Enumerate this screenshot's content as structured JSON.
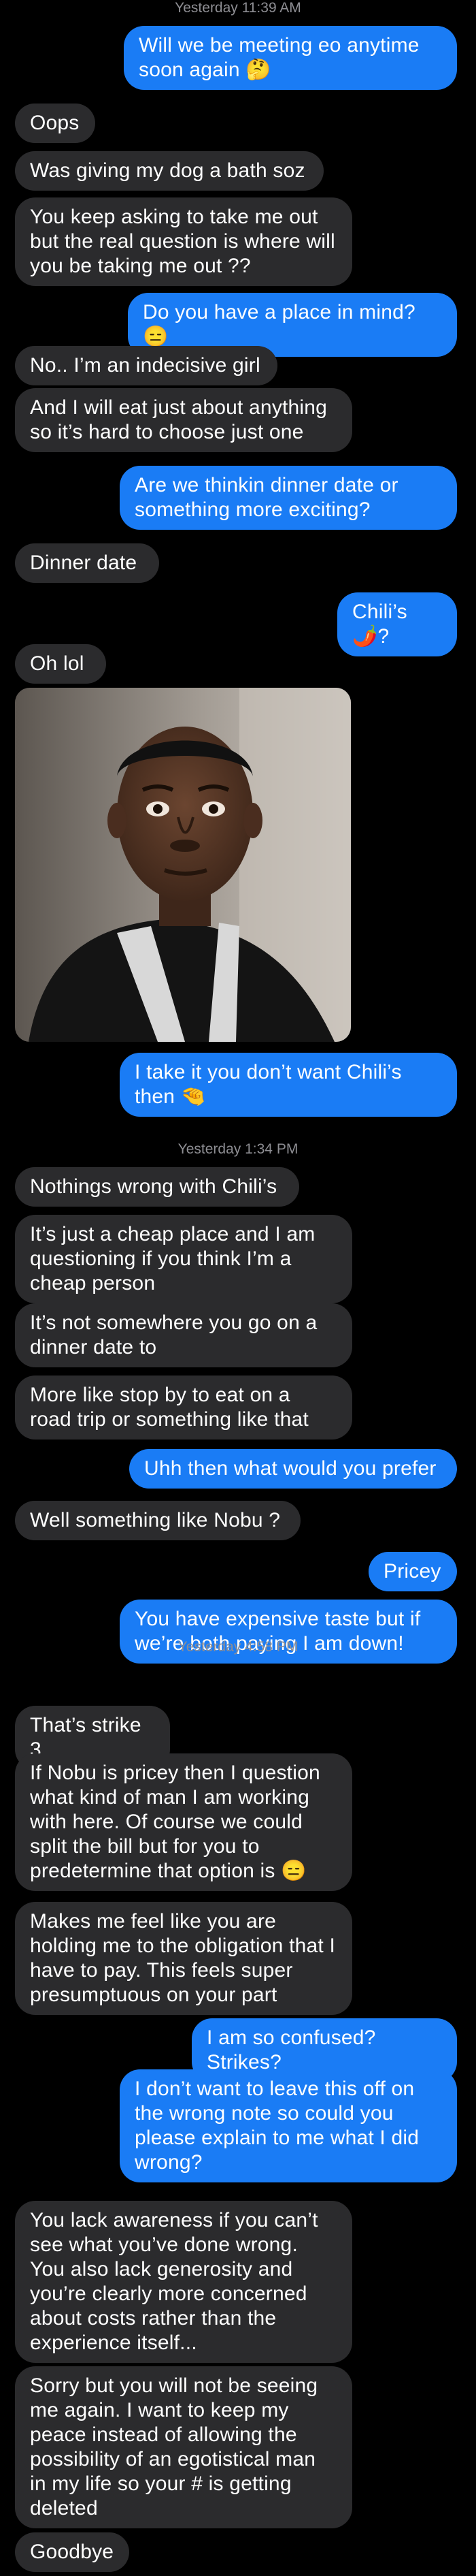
{
  "messages": [
    {
      "type": "timestamp",
      "text": "Yesterday 11:39 AM"
    },
    {
      "type": "sent",
      "text": "Will we be meeting eo anytime soon again 🤔"
    },
    {
      "type": "received",
      "text": "Oops"
    },
    {
      "type": "received",
      "text": "Was giving my dog a bath soz"
    },
    {
      "type": "received",
      "text": "You keep asking to take me out but the real question is where will you be taking me out ??"
    },
    {
      "type": "sent",
      "text": "Do you have a place in mind? 😑"
    },
    {
      "type": "received",
      "text": "No.. I’m an indecisive girl"
    },
    {
      "type": "received",
      "text": "And I will eat just about anything so it’s hard to choose just one"
    },
    {
      "type": "sent",
      "text": "Are we thinkin dinner date or something more exciting?"
    },
    {
      "type": "received",
      "text": "Dinner date"
    },
    {
      "type": "sent",
      "text": "Chili’s 🌶️?"
    },
    {
      "type": "received",
      "text": "Oh lol"
    },
    {
      "type": "image",
      "alt": "reaction photo of a surprised man wearing a lanyard"
    },
    {
      "type": "sent",
      "text": "I take it you don’t want Chili’s then 🤏"
    },
    {
      "type": "timestamp",
      "text": "Yesterday 1:34 PM"
    },
    {
      "type": "received",
      "text": "Nothings wrong with Chili’s"
    },
    {
      "type": "received",
      "text": "It’s just a cheap place and I am questioning if you think I’m a cheap person"
    },
    {
      "type": "received",
      "text": "It’s not somewhere you go on a dinner date to"
    },
    {
      "type": "received",
      "text": "More like stop by to eat on a road trip or something like that"
    },
    {
      "type": "sent",
      "text": "Uhh then what would you prefer"
    },
    {
      "type": "received",
      "text": "Well something like Nobu ?"
    },
    {
      "type": "sent",
      "text": "Pricey"
    },
    {
      "type": "sent",
      "text": "You have expensive taste but if we’re both paying I am down!"
    },
    {
      "type": "timestamp",
      "text": "Yesterday 4:58 PM"
    },
    {
      "type": "received",
      "text": "That’s strike 3"
    },
    {
      "type": "received",
      "text": "If Nobu is pricey then I question what kind of man I am working with here. Of course we could split the bill but for you to predetermine that option is 😑"
    },
    {
      "type": "received",
      "text": "Makes me feel like you are holding me to the obligation that I have to pay. This feels super presumptuous on your part"
    },
    {
      "type": "sent",
      "text": "I am so confused? Strikes?"
    },
    {
      "type": "sent",
      "text": "I don’t want to leave this off on the wrong note so could you please explain to me what I did wrong?"
    },
    {
      "type": "received",
      "text": "You lack awareness if you can’t see what you’ve done wrong. You also lack generosity and you’re clearly more concerned about costs rather than the experience itself..."
    },
    {
      "type": "received",
      "text": "Sorry but you will not be seeing me again. I want to keep my peace instead of allowing the possibility of an egotistical man in my life so your # is getting deleted"
    },
    {
      "type": "received",
      "text": "Goodbye"
    }
  ],
  "colors": {
    "background": "#000000",
    "sent_bubble": "#1a7cf5",
    "received_bubble": "#2b2b2d",
    "timestamp_text": "#8e8e93",
    "bubble_text": "#ffffff"
  }
}
